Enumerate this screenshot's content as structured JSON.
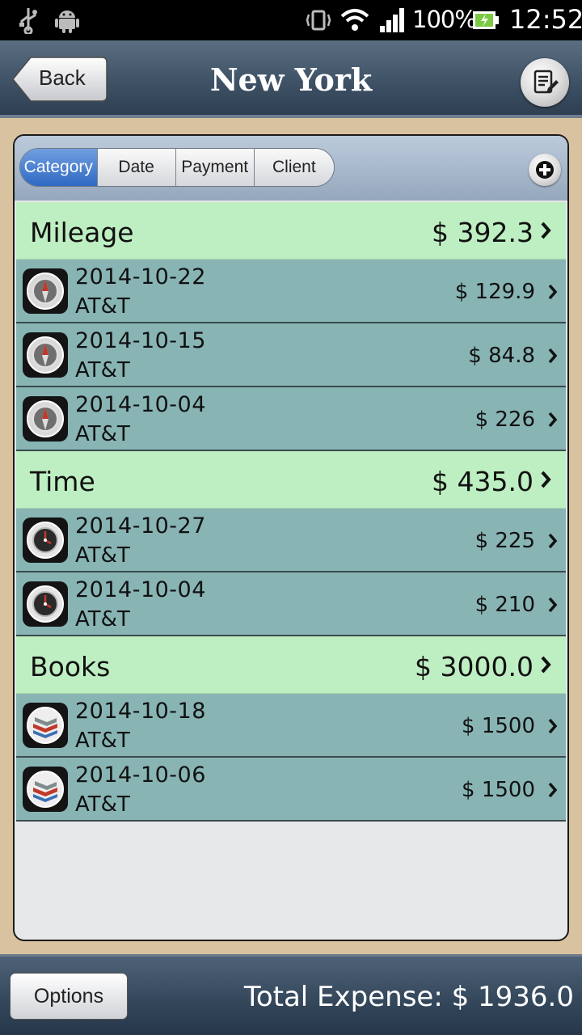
{
  "status_bar": {
    "battery": "100%",
    "time": "12:52"
  },
  "header": {
    "back_label": "Back",
    "title": "New York"
  },
  "tabs": [
    {
      "label": "Category",
      "active": true
    },
    {
      "label": "Date",
      "active": false
    },
    {
      "label": "Payment",
      "active": false
    },
    {
      "label": "Client",
      "active": false
    }
  ],
  "groups": [
    {
      "name": "Mileage",
      "total": "$ 392.3",
      "icon": "mileage-icon",
      "items": [
        {
          "date": "2014-10-22",
          "client": "AT&T",
          "amount": "$ 129.9"
        },
        {
          "date": "2014-10-15",
          "client": "AT&T",
          "amount": "$ 84.8"
        },
        {
          "date": "2014-10-04",
          "client": "AT&T",
          "amount": "$ 226"
        }
      ]
    },
    {
      "name": "Time",
      "total": "$ 435.0",
      "icon": "clock-icon",
      "items": [
        {
          "date": "2014-10-27",
          "client": "AT&T",
          "amount": "$ 225"
        },
        {
          "date": "2014-10-04",
          "client": "AT&T",
          "amount": "$ 210"
        }
      ]
    },
    {
      "name": "Books",
      "total": "$ 3000.0",
      "icon": "books-icon",
      "items": [
        {
          "date": "2014-10-18",
          "client": "AT&T",
          "amount": "$ 1500"
        },
        {
          "date": "2014-10-06",
          "client": "AT&T",
          "amount": "$ 1500"
        }
      ]
    }
  ],
  "footer": {
    "options_label": "Options",
    "total_label": "Total Expense: $ 1936.0"
  },
  "colors": {
    "category_bg": "#beefc2",
    "row_bg": "#88b4b4",
    "active_tab": "#2f69c3",
    "background": "#d8c29f"
  }
}
